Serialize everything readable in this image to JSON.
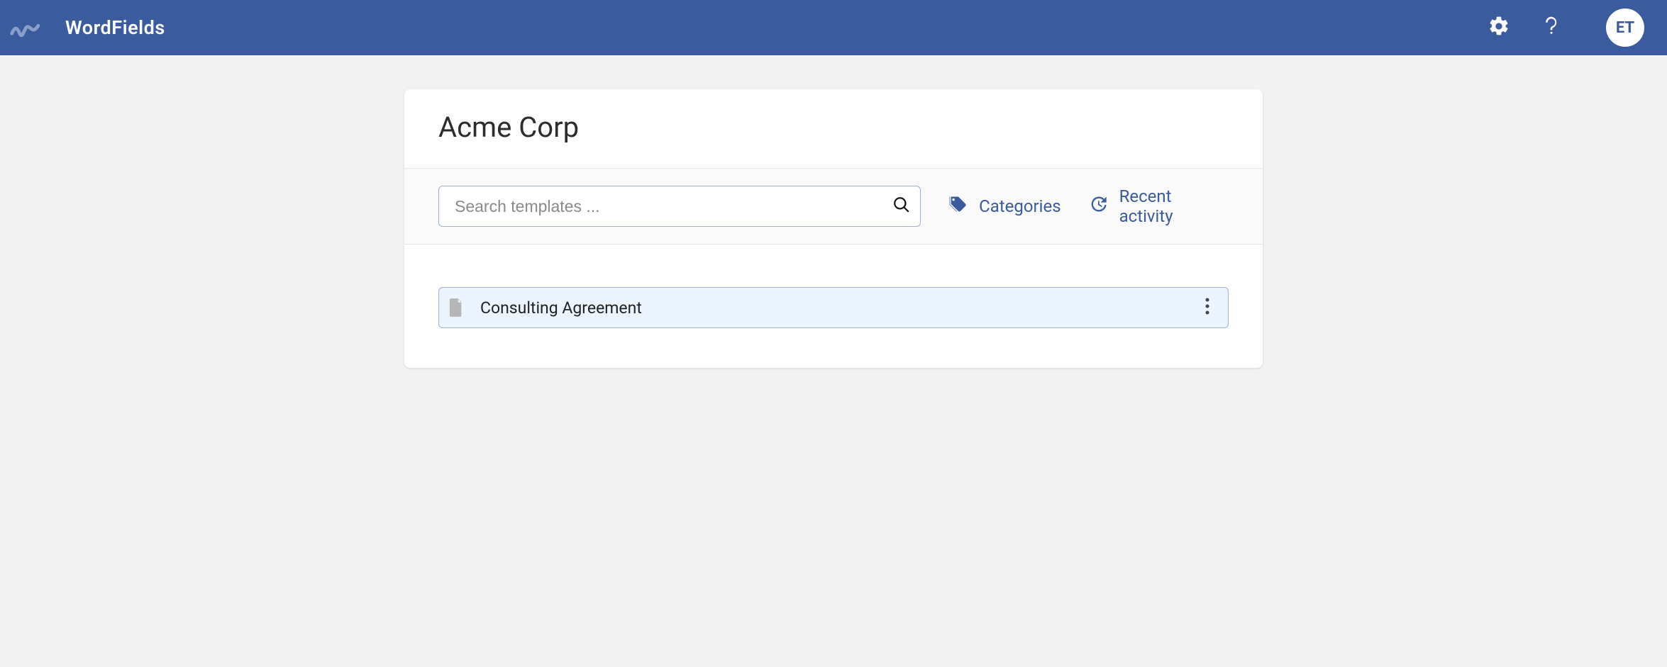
{
  "header": {
    "brand": "WordFields",
    "avatar_initials": "ET"
  },
  "page": {
    "title": "Acme Corp"
  },
  "toolbar": {
    "search_placeholder": "Search templates ...",
    "categories_label": "Categories",
    "recent_label": "Recent activity"
  },
  "templates": [
    {
      "name": "Consulting Agreement"
    }
  ]
}
